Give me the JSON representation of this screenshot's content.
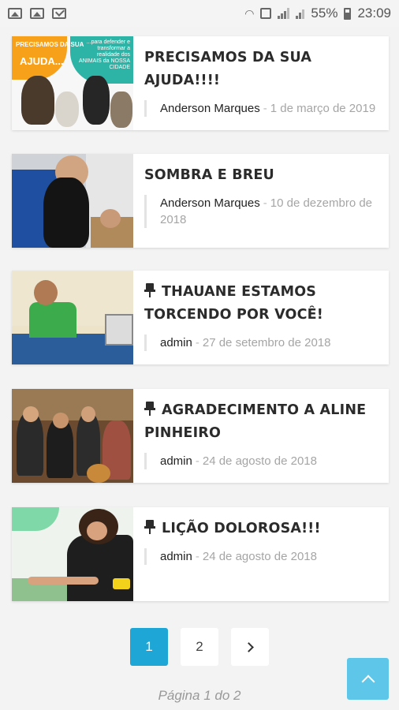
{
  "status_bar": {
    "battery": "55%",
    "time": "23:09"
  },
  "posts": [
    {
      "title": "PRECISAMOS DA SUA AJUDA!!!!",
      "pinned": false,
      "author": "Anderson Marques",
      "separator": "-",
      "date": "1 de março de 2019",
      "thumb_text": [
        "PRECISAMOS DA SUA",
        "AJUDA...",
        "...para defender e transformar a realidade dos ANIMAIS da NOSSA CIDADE"
      ]
    },
    {
      "title": "SOMBRA E BREU",
      "pinned": false,
      "author": "Anderson Marques",
      "separator": "-",
      "date": "10 de dezembro de 2018"
    },
    {
      "title": "THAUANE ESTAMOS TORCENDO POR VOCÊ!",
      "pinned": true,
      "author": "admin",
      "separator": "-",
      "date": "27 de setembro de 2018"
    },
    {
      "title": "AGRADECIMENTO A ALINE PINHEIRO",
      "pinned": true,
      "author": "admin",
      "separator": "-",
      "date": "24 de agosto de 2018"
    },
    {
      "title": "LIÇÃO DOLOROSA!!!",
      "pinned": true,
      "author": "admin",
      "separator": "-",
      "date": "24 de agosto de 2018"
    }
  ],
  "pagination": {
    "pages": [
      "1",
      "2"
    ],
    "current": "1",
    "info": "Página 1 do 2"
  },
  "icons": {
    "pin": "pin-icon",
    "next": "chevron-right-icon",
    "back_to_top": "chevron-up-icon"
  },
  "colors": {
    "accent": "#1ea7d6",
    "back_to_top": "#5ec6e8"
  }
}
